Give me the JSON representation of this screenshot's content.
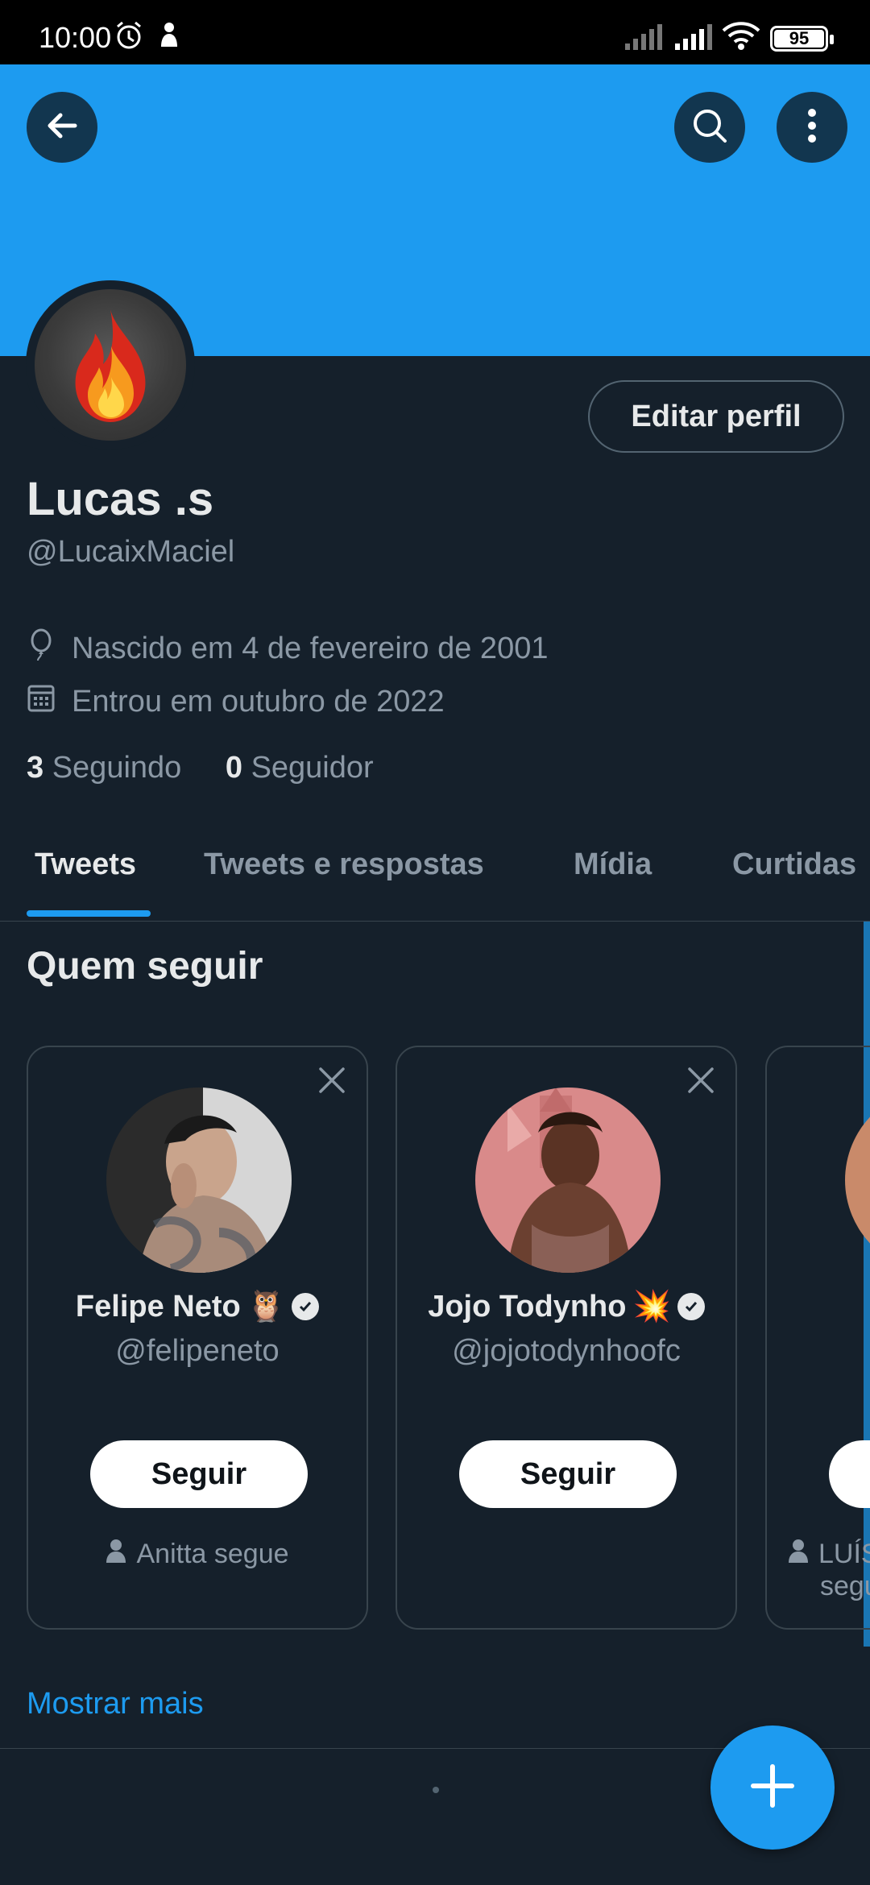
{
  "status_bar": {
    "time": "10:00",
    "battery": "95",
    "battery_level_percent": 95
  },
  "banner": {
    "color": "#1d9bf0",
    "back_icon": "arrow-left-icon",
    "search_icon": "search-icon",
    "more_icon": "more-vertical-icon"
  },
  "profile": {
    "edit_label": "Editar perfil",
    "display_name": "Lucas .s",
    "handle": "@LucaixMaciel",
    "birthday": "Nascido em 4 de fevereiro de 2001",
    "joined": "Entrou em outubro de 2022",
    "following_count": "3",
    "following_label": "Seguindo",
    "followers_count": "0",
    "followers_label": "Seguidor"
  },
  "tabs": [
    {
      "label": "Tweets",
      "active": true
    },
    {
      "label": "Tweets e respostas",
      "active": false
    },
    {
      "label": "Mídia",
      "active": false
    },
    {
      "label": "Curtidas",
      "active": false
    }
  ],
  "who_to_follow": {
    "title": "Quem seguir",
    "cards": [
      {
        "name": "Felipe Neto",
        "emoji": "🦉",
        "handle": "@felipeneto",
        "follow_label": "Seguir",
        "context": "Anitta segue"
      },
      {
        "name": "Jojo Todynho",
        "emoji": "💥",
        "handle": "@jojotodynhoofc",
        "follow_label": "Seguir",
        "context": ""
      },
      {
        "name": "",
        "handle": "",
        "follow_label": "",
        "context": "LUÍS",
        "context_line2": "segu"
      }
    ],
    "show_more": "Mostrar mais"
  },
  "fab": {
    "icon": "plus-icon",
    "color": "#1d9bf0"
  }
}
